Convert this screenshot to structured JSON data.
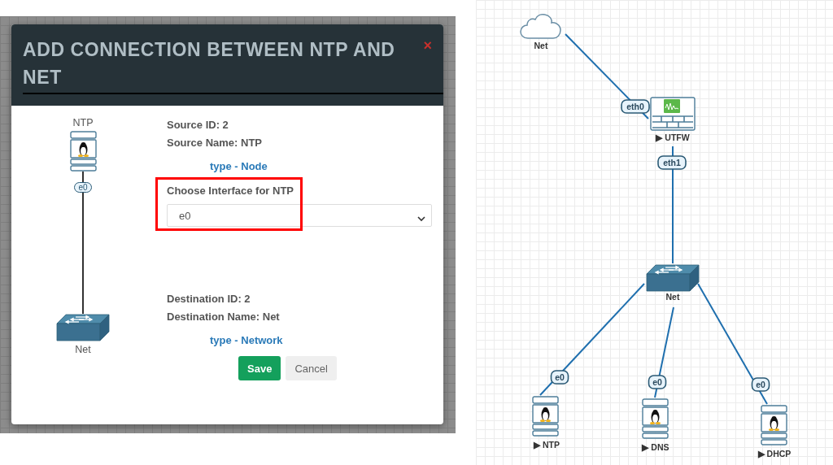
{
  "dialog": {
    "title": "ADD CONNECTION BETWEEN NTP AND NET",
    "close": "×",
    "source": {
      "node_label": "NTP",
      "port": "e0",
      "id": "Source ID: 2",
      "name": "Source Name: NTP",
      "type_link": "type - Node"
    },
    "interface": {
      "label": "Choose Interface for NTP",
      "value": "e0",
      "highlighted": true
    },
    "destination": {
      "node_label": "Net",
      "id": "Destination ID: 2",
      "name": "Destination Name: Net",
      "type_link": "type - Network"
    },
    "buttons": [
      {
        "label": "Save",
        "kind": "primary"
      },
      {
        "label": "Cancel",
        "kind": "secondary"
      }
    ]
  },
  "topology": {
    "nodes": [
      {
        "label": "Net",
        "kind": "cloud"
      },
      {
        "label": "▶ UTFW",
        "kind": "firewall"
      },
      {
        "label": "Net",
        "kind": "switch"
      },
      {
        "label": "▶ NTP",
        "kind": "linux"
      },
      {
        "label": "▶ DNS",
        "kind": "linux"
      },
      {
        "label": "▶ DHCP",
        "kind": "linux"
      }
    ],
    "links": [
      {
        "port": "eth0"
      },
      {
        "port": "eth1"
      },
      {
        "port": "e0"
      },
      {
        "port": "e0"
      },
      {
        "port": "e0"
      }
    ]
  }
}
